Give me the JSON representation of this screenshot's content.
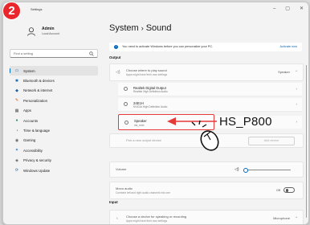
{
  "badge": "2",
  "window": {
    "title": "Settings",
    "controls": [
      "–",
      "▢",
      "✕"
    ]
  },
  "profile": {
    "name": "Admin",
    "subtitle": "Local Account"
  },
  "search": {
    "placeholder": "Find a setting",
    "icon": "search-icon"
  },
  "nav": [
    {
      "label": "System",
      "icon": "monitor-icon",
      "glyph": "▭",
      "color": "#0067c0",
      "active": true
    },
    {
      "label": "Bluetooth & devices",
      "icon": "bluetooth-icon",
      "glyph": "✱",
      "color": "#0067c0"
    },
    {
      "label": "Network & internet",
      "icon": "network-icon",
      "glyph": "◆",
      "color": "#1a5ea8"
    },
    {
      "label": "Personalization",
      "icon": "brush-icon",
      "glyph": "✎",
      "color": "#d35400"
    },
    {
      "label": "Apps",
      "icon": "apps-icon",
      "glyph": "▦",
      "color": "#555555"
    },
    {
      "label": "Accounts",
      "icon": "accounts-icon",
      "glyph": "●",
      "color": "#2e8b57"
    },
    {
      "label": "Time & language",
      "icon": "clock-icon",
      "glyph": "◔",
      "color": "#0067c0"
    },
    {
      "label": "Gaming",
      "icon": "gaming-icon",
      "glyph": "◉",
      "color": "#666666"
    },
    {
      "label": "Accessibility",
      "icon": "accessibility-icon",
      "glyph": "✶",
      "color": "#0067c0"
    },
    {
      "label": "Privacy & security",
      "icon": "shield-icon",
      "glyph": "◈",
      "color": "#555555"
    },
    {
      "label": "Windows Update",
      "icon": "update-icon",
      "glyph": "⟳",
      "color": "#0067c0"
    }
  ],
  "breadcrumb": {
    "parent": "System",
    "separator": "›",
    "current": "Sound"
  },
  "banner": {
    "text": "You need to activate Windows before you can personalize your PC.",
    "link": "Activate now"
  },
  "output": {
    "section": "Output",
    "choose": {
      "title": "Choose where to play sound",
      "subtitle": "Apps might have their own settings",
      "value": "Speaker",
      "chevron": "⌃"
    },
    "devices": [
      {
        "name": "Realtek Digital Output",
        "sub": "Realtek High Definition Audio",
        "chevron": "›"
      },
      {
        "name": "24E1H",
        "sub": "NVIDIA High Definition Audio",
        "chevron": "›"
      },
      {
        "name": "Speaker",
        "sub": "via_mob",
        "chevron": "›",
        "highlighted": true
      }
    ],
    "pair": {
      "label": "Pair a new output device",
      "button": "Add device"
    },
    "volume": {
      "label": "Volume",
      "level": 0.0,
      "icon": "speaker-icon"
    },
    "mono": {
      "title": "Mono audio",
      "subtitle": "Combine left and right audio channels into one",
      "state": "Off"
    }
  },
  "input": {
    "section": "Input",
    "choose": {
      "title": "Choose a device for speaking or recording",
      "subtitle": "Apps might have their own settings",
      "value": "Microphone",
      "chevron": "⌃"
    }
  },
  "annotation": {
    "label": "HS_P800",
    "color": "#e53a3a",
    "icon": "mouse-click-icon"
  }
}
